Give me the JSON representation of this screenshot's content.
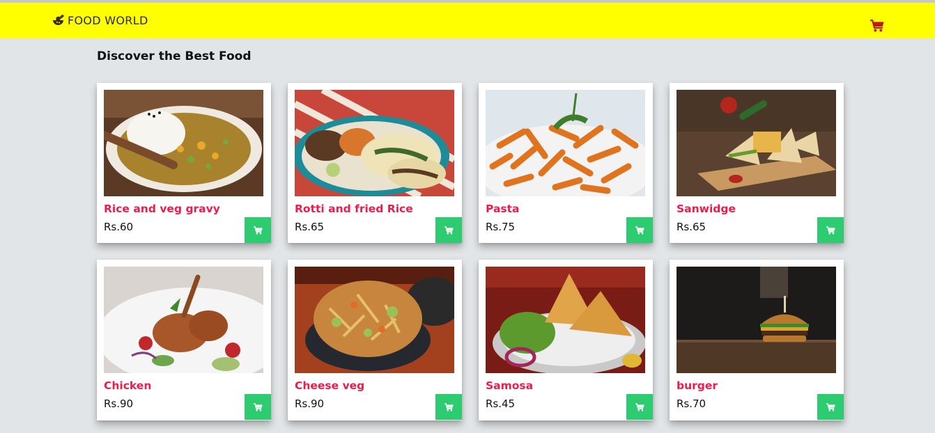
{
  "navbar": {
    "brand": "FOOD WORLD",
    "brand_icon": "food-bowl-icon",
    "cart_icon": "shopping-cart-icon",
    "background": "#ffff00"
  },
  "heading": "Discover the Best Food",
  "colors": {
    "item_name": "#ee1c4a",
    "cart_button": "#2ecc71",
    "page_background": "#e2e5e7"
  },
  "items": [
    {
      "name": "Rice and veg gravy",
      "price": "Rs.60"
    },
    {
      "name": "Rotti and fried Rice",
      "price": "Rs.65"
    },
    {
      "name": "Pasta",
      "price": "Rs.75"
    },
    {
      "name": "Sanwidge",
      "price": "Rs.65"
    },
    {
      "name": "Chicken",
      "price": "Rs.90"
    },
    {
      "name": "Cheese veg",
      "price": "Rs.90"
    },
    {
      "name": "Samosa",
      "price": "Rs.45"
    },
    {
      "name": "burger",
      "price": "Rs.70"
    }
  ]
}
